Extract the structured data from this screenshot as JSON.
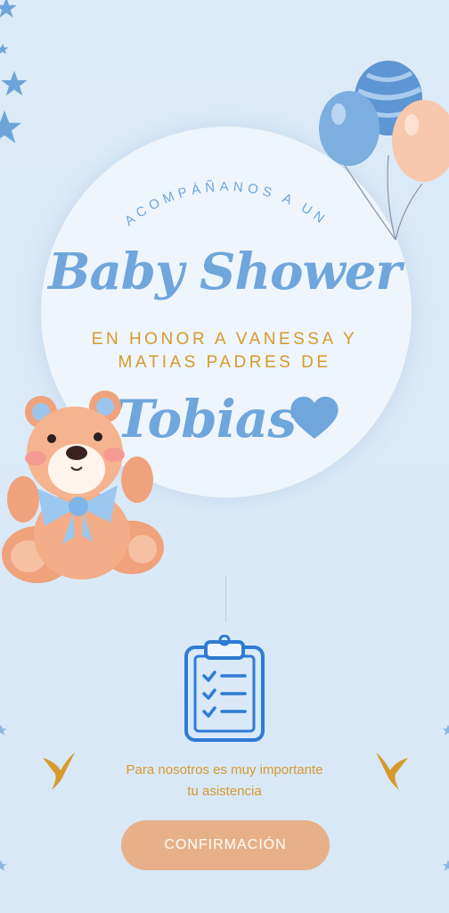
{
  "invitation": {
    "arc_text": "ACOMPÁÑANOS A UN",
    "title": "Baby Shower",
    "honor_line1": "EN HONOR A VANESSA Y",
    "honor_line2": "MATIAS PADRES DE",
    "baby_name": "Tobias"
  },
  "rsvp": {
    "message_line1": "Para nosotros es muy importante",
    "message_line2": "tu asistencia",
    "button_label": "CONFIRMACIÓN"
  },
  "icons": [
    "star-icon",
    "balloons-icon",
    "heart-icon",
    "teddy-bear-icon",
    "clipboard-icon",
    "swallow-icon"
  ],
  "colors": {
    "background": "#dbeaf8",
    "circle": "#eef5fc",
    "accent_blue": "#6fa6db",
    "accent_gold": "#d69a2c",
    "button": "#e8b088"
  }
}
